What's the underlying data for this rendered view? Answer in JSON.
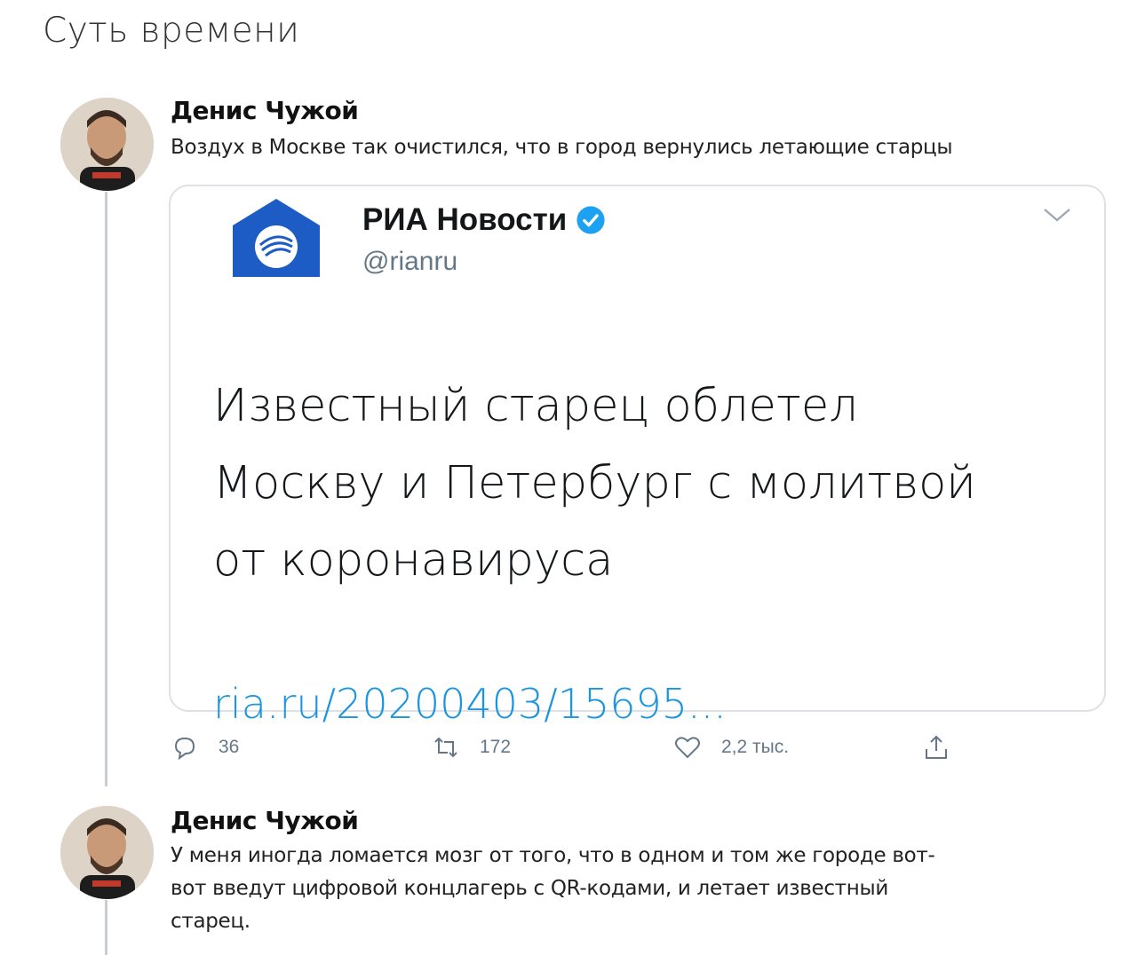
{
  "page": {
    "title": "Суть времени"
  },
  "tweets": [
    {
      "author": "Денис Чужой",
      "text": "Воздух в Москве так очистился, что в город вернулись летающие старцы",
      "quote": {
        "name": "РИА Новости",
        "handle": "@rianru",
        "verified": true,
        "body_lines": [
          "Известный старец облетел",
          "Москву и Петербург с молитвой",
          "от коронавируса"
        ],
        "link": "ria.ru/20200403/15695..."
      },
      "actions": {
        "replies": "36",
        "retweets": "172",
        "likes": "2,2 тыс."
      }
    },
    {
      "author": "Денис Чужой",
      "text_lines": [
        "У меня иногда ломается мозг от того, что в одном и том же городе вот-",
        "вот введут цифровой концлагерь с QR-кодами, и летает известный",
        "старец."
      ]
    }
  ],
  "icons": [
    "reply-icon",
    "retweet-icon",
    "like-icon",
    "share-icon",
    "verified-icon",
    "chevron-down-icon",
    "ria-logo-icon"
  ],
  "colors": {
    "link": "#1b95e0",
    "verified": "#1da1f2",
    "ria_blue": "#1d5cc4",
    "muted": "#657786"
  }
}
